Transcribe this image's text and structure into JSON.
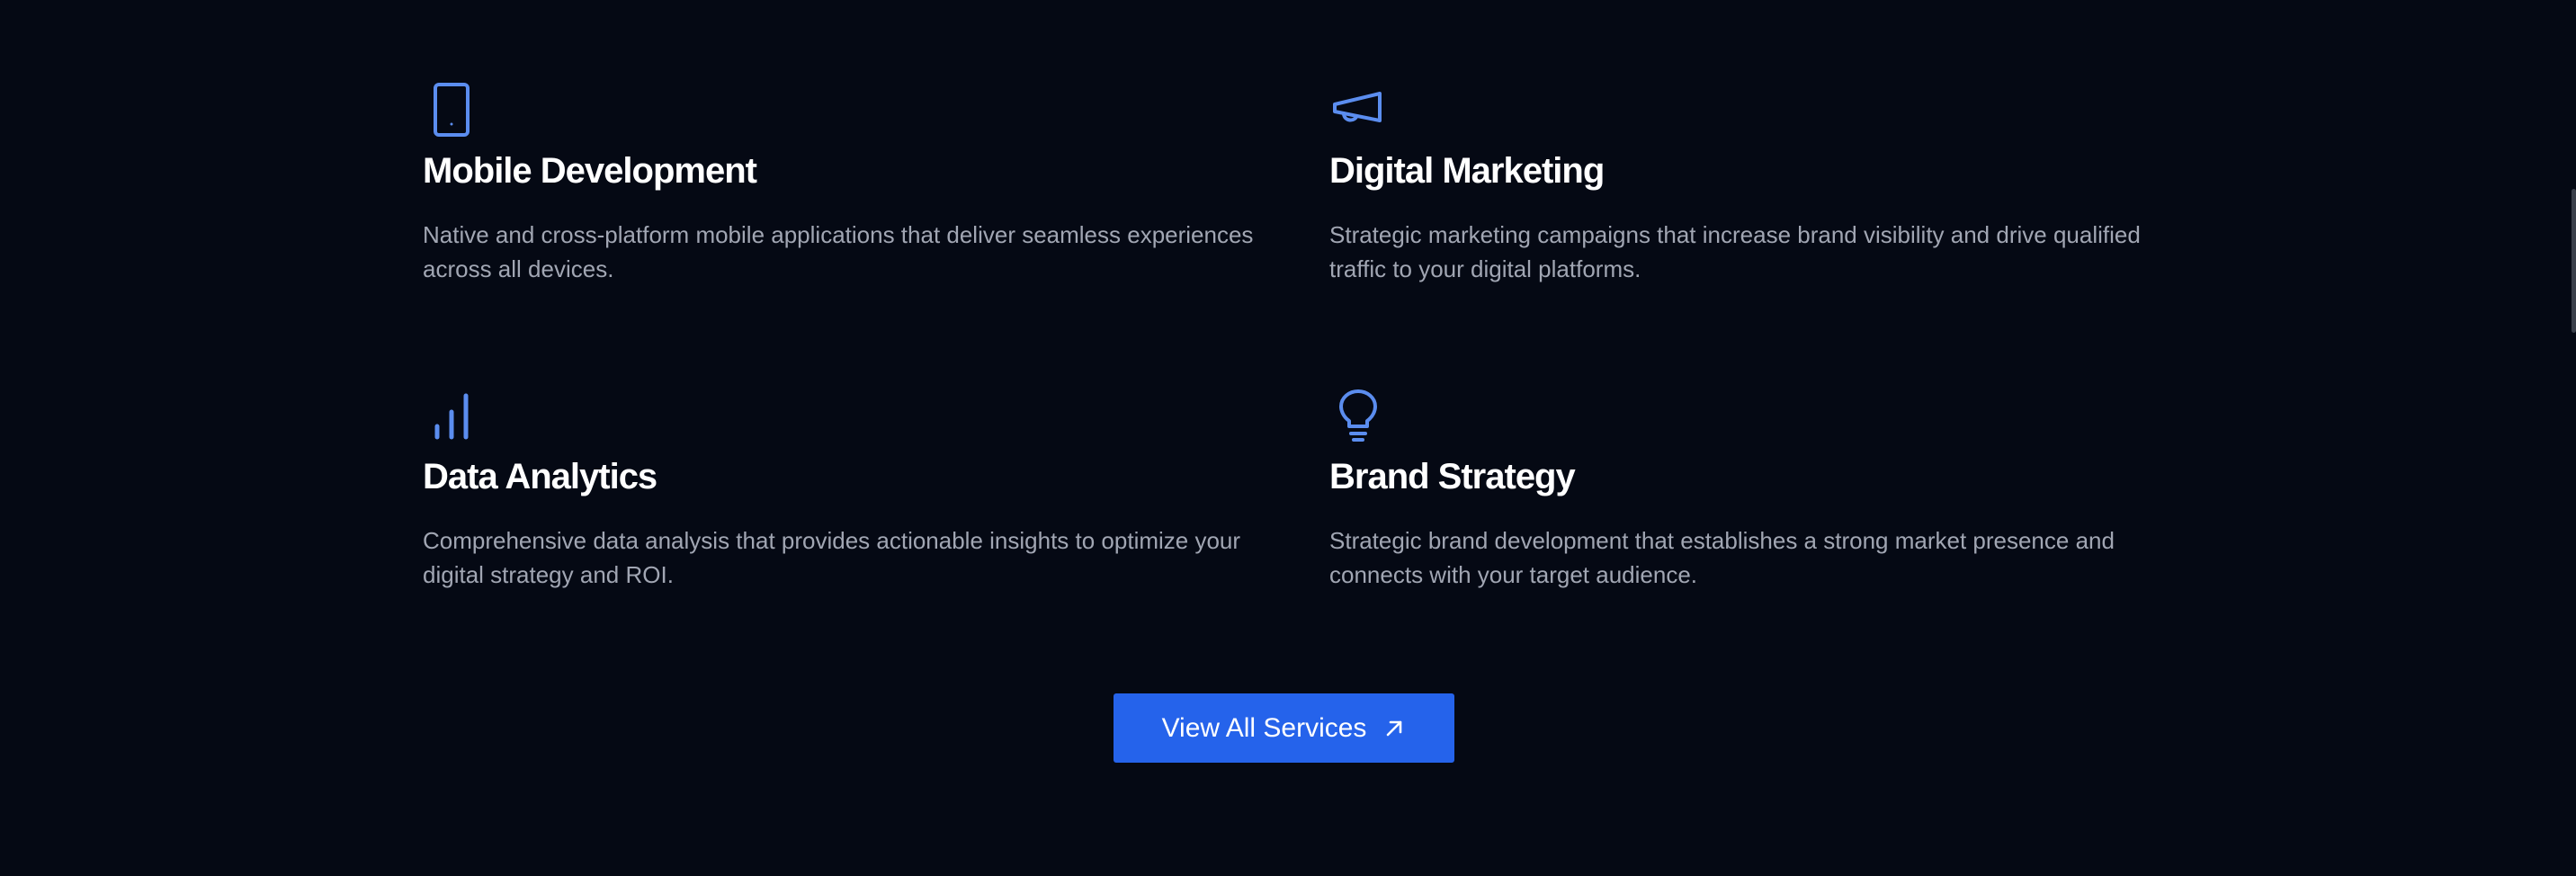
{
  "services": [
    {
      "id": "mobile",
      "icon": "tablet-icon",
      "title": "Mobile Development",
      "description": "Native and cross-platform mobile applications that deliver seamless experiences across all devices."
    },
    {
      "id": "marketing",
      "icon": "megaphone-icon",
      "title": "Digital Marketing",
      "description": "Strategic marketing campaigns that increase brand visibility and drive qualified traffic to your digital platforms."
    },
    {
      "id": "analytics",
      "icon": "bar-chart-icon",
      "title": "Data Analytics",
      "description": "Comprehensive data analysis that provides actionable insights to optimize your digital strategy and ROI."
    },
    {
      "id": "brand",
      "icon": "lightbulb-icon",
      "title": "Brand Strategy",
      "description": "Strategic brand development that establishes a strong market presence and connects with your target audience."
    }
  ],
  "cta": {
    "label": "View All Services",
    "icon": "arrow-up-right-icon"
  },
  "colors": {
    "background": "#050914",
    "accent": "#2563eb",
    "icon": "#5b8def",
    "title": "#ffffff",
    "body": "#a1a6b3"
  }
}
